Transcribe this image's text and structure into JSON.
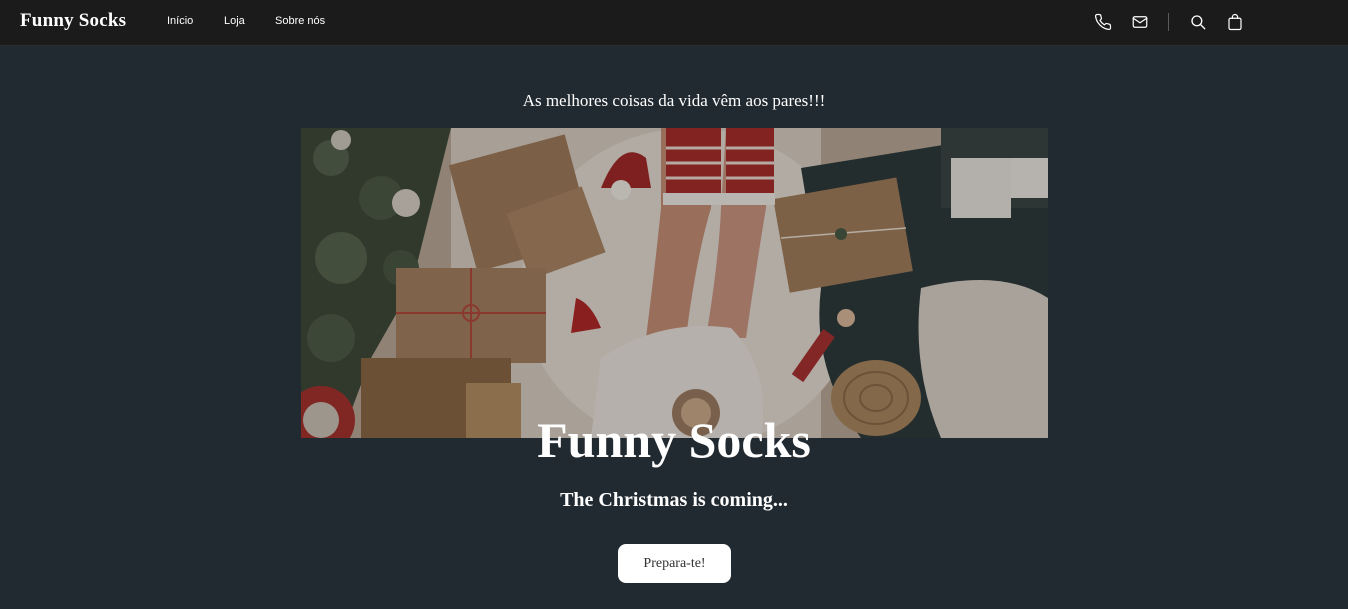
{
  "navbar": {
    "brand": "Funny Socks",
    "links": [
      {
        "label": "Início"
      },
      {
        "label": "Loja"
      },
      {
        "label": "Sobre nós"
      }
    ],
    "icons": [
      "phone-icon",
      "mail-icon",
      "search-icon",
      "shopping-bag-icon"
    ]
  },
  "hero": {
    "tagline": "As melhores coisas da vida vêm aos pares!!!",
    "title": "Funny Socks",
    "subtitle": "The Christmas is coming...",
    "cta_label": "Prepara-te!"
  },
  "colors": {
    "navbar_bg": "#1b1b1b",
    "page_bg": "#222a31",
    "text": "#ffffff",
    "button_bg": "#ffffff"
  }
}
